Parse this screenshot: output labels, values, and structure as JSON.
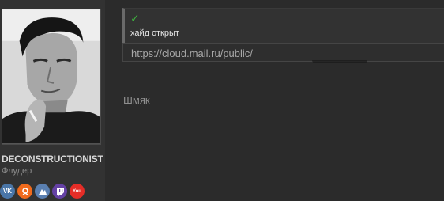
{
  "user": {
    "name": "DECONSTRUCTIONIST",
    "title": "Флудер",
    "socials": [
      {
        "icon": "vk-icon",
        "label": "VK",
        "color": "#4a76a8"
      },
      {
        "icon": "odnoklassniki-icon",
        "label": "OK",
        "color": "#f06a1c"
      },
      {
        "icon": "steam-icon",
        "label": "S",
        "color": "#5a7fb0"
      },
      {
        "icon": "twitch-icon",
        "label": "T",
        "color": "#6441a4"
      },
      {
        "icon": "youtube-icon",
        "label": "You",
        "color": "#e52d27"
      }
    ]
  },
  "post": {
    "hide_check": "✓",
    "hide_text": "хайд открыт",
    "link": "https://cloud.mail.ru/public/",
    "message": "Шмяк"
  }
}
